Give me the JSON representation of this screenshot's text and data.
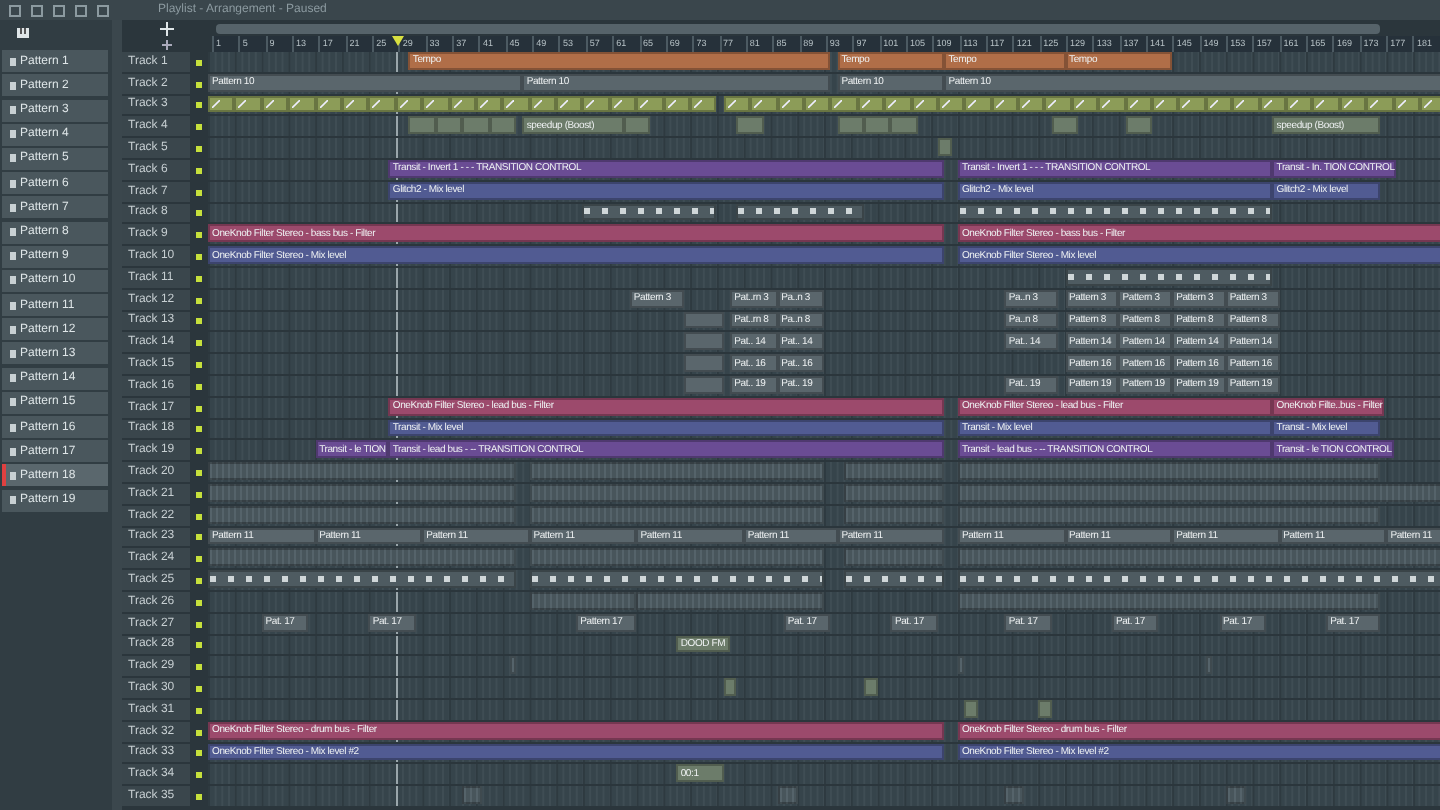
{
  "window": {
    "title": "Playlist - Arrangement - Paused"
  },
  "patterns": [
    {
      "label": "Pattern 1",
      "selected": false
    },
    {
      "label": "Pattern 2",
      "selected": false
    },
    {
      "label": "Pattern 3",
      "selected": false
    },
    {
      "label": "Pattern 4",
      "selected": false
    },
    {
      "label": "Pattern 5",
      "selected": false
    },
    {
      "label": "Pattern 6",
      "selected": false
    },
    {
      "label": "Pattern 7",
      "selected": false
    },
    {
      "label": "Pattern 8",
      "selected": false
    },
    {
      "label": "Pattern 9",
      "selected": false
    },
    {
      "label": "Pattern 10",
      "selected": false
    },
    {
      "label": "Pattern 11",
      "selected": false
    },
    {
      "label": "Pattern 12",
      "selected": false
    },
    {
      "label": "Pattern 13",
      "selected": false
    },
    {
      "label": "Pattern 14",
      "selected": false
    },
    {
      "label": "Pattern 15",
      "selected": false
    },
    {
      "label": "Pattern 16",
      "selected": false
    },
    {
      "label": "Pattern 17",
      "selected": false
    },
    {
      "label": "Pattern 18",
      "selected": true
    },
    {
      "label": "Pattern 19",
      "selected": false
    }
  ],
  "ruler": {
    "marks": [
      "1",
      "5",
      "9",
      "13",
      "17",
      "21",
      "25",
      "29",
      "33",
      "37",
      "41",
      "45",
      "49",
      "53",
      "57",
      "61",
      "65",
      "69",
      "73",
      "77",
      "81",
      "85",
      "89",
      "93",
      "97",
      "101",
      "105",
      "109",
      "113",
      "117",
      "121",
      "125",
      "129",
      "133",
      "137",
      "141",
      "145",
      "149",
      "153",
      "157",
      "161",
      "165",
      "169",
      "173",
      "177",
      "181"
    ]
  },
  "tracks": [
    {
      "name": "Track 1",
      "active": true,
      "clips": [
        {
          "kind": "tempo",
          "label": "Tempo"
        },
        {
          "kind": "tempo",
          "label": "Tempo"
        },
        {
          "kind": "tempo",
          "label": "Tempo"
        },
        {
          "kind": "tempo",
          "label": "Tempo"
        }
      ]
    },
    {
      "name": "Track 2",
      "active": true,
      "clips": [
        {
          "kind": "pattern",
          "label": "Pattern 10"
        },
        {
          "kind": "pattern",
          "label": "Pattern 10"
        },
        {
          "kind": "pattern",
          "label": "Pattern 10"
        },
        {
          "kind": "pattern",
          "label": "Pattern 10"
        }
      ]
    },
    {
      "name": "Track 3",
      "active": true,
      "clips": [
        {
          "kind": "automation"
        },
        {
          "kind": "automation"
        }
      ]
    },
    {
      "name": "Track 4",
      "active": true,
      "clips": [
        {
          "kind": "audio"
        },
        {
          "kind": "audio"
        },
        {
          "kind": "audio"
        },
        {
          "kind": "audio"
        },
        {
          "kind": "audio",
          "label": "speedup (Boost)"
        },
        {
          "kind": "audio"
        },
        {
          "kind": "audio"
        },
        {
          "kind": "audio"
        },
        {
          "kind": "audio"
        },
        {
          "kind": "audio"
        },
        {
          "kind": "audio"
        },
        {
          "kind": "audio"
        },
        {
          "kind": "audio",
          "label": "speedup (Boost)"
        }
      ]
    },
    {
      "name": "Track 5",
      "active": true,
      "clips": [
        {
          "kind": "audio"
        }
      ]
    },
    {
      "name": "Track 6",
      "active": true,
      "clips": [
        {
          "kind": "transit",
          "label": "Transit - Invert 1 - - - TRANSITION CONTROL"
        },
        {
          "kind": "transit",
          "label": "Transit - Invert 1 - - - TRANSITION CONTROL"
        },
        {
          "kind": "transit",
          "label": "Transit - In. TION CONTROL"
        }
      ]
    },
    {
      "name": "Track 7",
      "active": true,
      "clips": [
        {
          "kind": "mix",
          "label": "Glitch2 - Mix level"
        },
        {
          "kind": "mix",
          "label": "Glitch2 - Mix level"
        },
        {
          "kind": "mix",
          "label": "Glitch2 - Mix level"
        }
      ]
    },
    {
      "name": "Track 8",
      "active": true,
      "clips": [
        {
          "kind": "notes"
        },
        {
          "kind": "notes"
        },
        {
          "kind": "notes"
        }
      ]
    },
    {
      "name": "Track 9",
      "active": true,
      "clips": [
        {
          "kind": "filter",
          "label": "OneKnob Filter Stereo - bass bus - Filter"
        },
        {
          "kind": "filter",
          "label": "OneKnob Filter Stereo - bass bus - Filter"
        }
      ]
    },
    {
      "name": "Track 10",
      "active": true,
      "clips": [
        {
          "kind": "mix",
          "label": "OneKnob Filter Stereo - Mix level"
        },
        {
          "kind": "mix",
          "label": "OneKnob Filter Stereo - Mix level"
        }
      ]
    },
    {
      "name": "Track 11",
      "active": true,
      "clips": [
        {
          "kind": "notes"
        }
      ]
    },
    {
      "name": "Track 12",
      "active": true,
      "clips": [
        {
          "kind": "pattern",
          "label": "Pattern 3"
        },
        {
          "kind": "pattern",
          "label": "Pat..rn 3"
        },
        {
          "kind": "pattern",
          "label": "Pa..n 3"
        },
        {
          "kind": "pattern",
          "label": "Pa..n 3"
        },
        {
          "kind": "pattern",
          "label": "Pattern 3"
        },
        {
          "kind": "pattern",
          "label": "Pattern 3"
        },
        {
          "kind": "pattern",
          "label": "Pattern 3"
        },
        {
          "kind": "pattern",
          "label": "Pattern 3"
        }
      ]
    },
    {
      "name": "Track 13",
      "active": true,
      "clips": [
        {
          "kind": "pattern"
        },
        {
          "kind": "pattern",
          "label": "Pat..rn 8"
        },
        {
          "kind": "pattern",
          "label": "Pa..n 8"
        },
        {
          "kind": "pattern",
          "label": "Pa..n 8"
        },
        {
          "kind": "pattern",
          "label": "Pattern 8"
        },
        {
          "kind": "pattern",
          "label": "Pattern 8"
        },
        {
          "kind": "pattern",
          "label": "Pattern 8"
        },
        {
          "kind": "pattern",
          "label": "Pattern 8"
        }
      ]
    },
    {
      "name": "Track 14",
      "active": true,
      "clips": [
        {
          "kind": "pattern"
        },
        {
          "kind": "pattern",
          "label": "Pat.. 14"
        },
        {
          "kind": "pattern",
          "label": "Pat.. 14"
        },
        {
          "kind": "pattern",
          "label": "Pat.. 14"
        },
        {
          "kind": "pattern",
          "label": "Pattern 14"
        },
        {
          "kind": "pattern",
          "label": "Pattern 14"
        },
        {
          "kind": "pattern",
          "label": "Pattern 14"
        },
        {
          "kind": "pattern",
          "label": "Pattern 14"
        }
      ]
    },
    {
      "name": "Track 15",
      "active": true,
      "clips": [
        {
          "kind": "pattern"
        },
        {
          "kind": "pattern",
          "label": "Pat.. 16"
        },
        {
          "kind": "pattern",
          "label": "Pat.. 16"
        },
        {
          "kind": "pattern",
          "label": "Pattern 16"
        },
        {
          "kind": "pattern",
          "label": "Pattern 16"
        },
        {
          "kind": "pattern",
          "label": "Pattern 16"
        },
        {
          "kind": "pattern",
          "label": "Pattern 16"
        }
      ]
    },
    {
      "name": "Track 16",
      "active": true,
      "clips": [
        {
          "kind": "pattern"
        },
        {
          "kind": "pattern",
          "label": "Pat.. 19"
        },
        {
          "kind": "pattern",
          "label": "Pat.. 19"
        },
        {
          "kind": "pattern",
          "label": "Pat.. 19"
        },
        {
          "kind": "pattern",
          "label": "Pattern 19"
        },
        {
          "kind": "pattern",
          "label": "Pattern 19"
        },
        {
          "kind": "pattern",
          "label": "Pattern 19"
        },
        {
          "kind": "pattern",
          "label": "Pattern 19"
        }
      ]
    },
    {
      "name": "Track 17",
      "active": true,
      "clips": [
        {
          "kind": "filter",
          "label": "OneKnob Filter Stereo - lead bus - Filter"
        },
        {
          "kind": "filter",
          "label": "OneKnob Filter Stereo - lead bus - Filter"
        },
        {
          "kind": "filter",
          "label": "OneKnob Filte..bus - Filter"
        }
      ]
    },
    {
      "name": "Track 18",
      "active": true,
      "clips": [
        {
          "kind": "mix",
          "label": "Transit - Mix level"
        },
        {
          "kind": "mix",
          "label": "Transit - Mix level"
        },
        {
          "kind": "mix",
          "label": "Transit - Mix level"
        }
      ]
    },
    {
      "name": "Track 19",
      "active": true,
      "clips": [
        {
          "kind": "transit",
          "label": "Transit - le TION"
        },
        {
          "kind": "transit",
          "label": "Transit - lead bus - -- TRANSITION CONTROL"
        },
        {
          "kind": "transit",
          "label": "Transit - lead bus - -- TRANSITION CONTROL"
        },
        {
          "kind": "transit",
          "label": "Transit - le TION CONTROL"
        }
      ]
    },
    {
      "name": "Track 20",
      "active": true,
      "clips": [
        {
          "kind": "block"
        },
        {
          "kind": "block"
        },
        {
          "kind": "block"
        },
        {
          "kind": "block"
        }
      ]
    },
    {
      "name": "Track 21",
      "active": true,
      "clips": [
        {
          "kind": "block"
        },
        {
          "kind": "block"
        },
        {
          "kind": "block"
        },
        {
          "kind": "block"
        }
      ]
    },
    {
      "name": "Track 22",
      "active": true,
      "clips": [
        {
          "kind": "block"
        },
        {
          "kind": "block"
        },
        {
          "kind": "block"
        },
        {
          "kind": "block"
        }
      ]
    },
    {
      "name": "Track 23",
      "active": true,
      "clips": [
        {
          "kind": "pattern",
          "label": "Pattern 11"
        },
        {
          "kind": "pattern",
          "label": "Pattern 11"
        },
        {
          "kind": "pattern",
          "label": "Pattern 11"
        },
        {
          "kind": "pattern",
          "label": "Pattern 11"
        },
        {
          "kind": "pattern",
          "label": "Pattern 11"
        },
        {
          "kind": "pattern",
          "label": "Pattern 11"
        },
        {
          "kind": "pattern",
          "label": "Pattern 11"
        },
        {
          "kind": "pattern",
          "label": "Pattern 11"
        },
        {
          "kind": "pattern",
          "label": "Pattern 11"
        },
        {
          "kind": "pattern",
          "label": "Pattern 11"
        },
        {
          "kind": "pattern",
          "label": "Pattern 11"
        },
        {
          "kind": "pattern",
          "label": "Pattern 11"
        }
      ]
    },
    {
      "name": "Track 24",
      "active": true,
      "clips": [
        {
          "kind": "block"
        },
        {
          "kind": "block"
        },
        {
          "kind": "block"
        },
        {
          "kind": "block"
        }
      ]
    },
    {
      "name": "Track 25",
      "active": true,
      "clips": [
        {
          "kind": "notes"
        },
        {
          "kind": "notes"
        },
        {
          "kind": "notes"
        },
        {
          "kind": "notes"
        }
      ]
    },
    {
      "name": "Track 26",
      "active": true,
      "clips": [
        {
          "kind": "block"
        },
        {
          "kind": "block"
        },
        {
          "kind": "block"
        }
      ]
    },
    {
      "name": "Track 27",
      "active": true,
      "clips": [
        {
          "kind": "pattern",
          "label": "Pat. 17"
        },
        {
          "kind": "pattern",
          "label": "Pat. 17"
        },
        {
          "kind": "pattern",
          "label": "Pattern 17"
        },
        {
          "kind": "pattern",
          "label": "Pat. 17"
        },
        {
          "kind": "pattern",
          "label": "Pat. 17"
        },
        {
          "kind": "pattern",
          "label": "Pat. 17"
        },
        {
          "kind": "pattern",
          "label": "Pat. 17"
        },
        {
          "kind": "pattern",
          "label": "Pat. 17"
        },
        {
          "kind": "pattern",
          "label": "Pat. 17"
        }
      ]
    },
    {
      "name": "Track 28",
      "active": true,
      "clips": [
        {
          "kind": "audio",
          "label": "DOOD FM"
        }
      ]
    },
    {
      "name": "Track 29",
      "active": true,
      "clips": [
        {
          "kind": "block"
        },
        {
          "kind": "block"
        },
        {
          "kind": "block"
        }
      ]
    },
    {
      "name": "Track 30",
      "active": true,
      "clips": [
        {
          "kind": "audio"
        },
        {
          "kind": "audio"
        }
      ]
    },
    {
      "name": "Track 31",
      "active": true,
      "clips": [
        {
          "kind": "audio"
        },
        {
          "kind": "audio"
        }
      ]
    },
    {
      "name": "Track 32",
      "active": true,
      "clips": [
        {
          "kind": "filter",
          "label": "OneKnob Filter Stereo - drum bus - Filter"
        },
        {
          "kind": "filter",
          "label": "OneKnob Filter Stereo - drum bus - Filter"
        }
      ]
    },
    {
      "name": "Track 33",
      "active": true,
      "clips": [
        {
          "kind": "mix",
          "label": "OneKnob Filter Stereo - Mix level #2"
        },
        {
          "kind": "mix",
          "label": "OneKnob Filter Stereo - Mix level #2"
        }
      ]
    },
    {
      "name": "Track 34",
      "active": true,
      "clips": [
        {
          "kind": "audio",
          "label": "00:1"
        }
      ]
    },
    {
      "name": "Track 35",
      "active": true,
      "clips": [
        {
          "kind": "block"
        },
        {
          "kind": "block"
        },
        {
          "kind": "block"
        },
        {
          "kind": "block"
        }
      ]
    }
  ]
}
